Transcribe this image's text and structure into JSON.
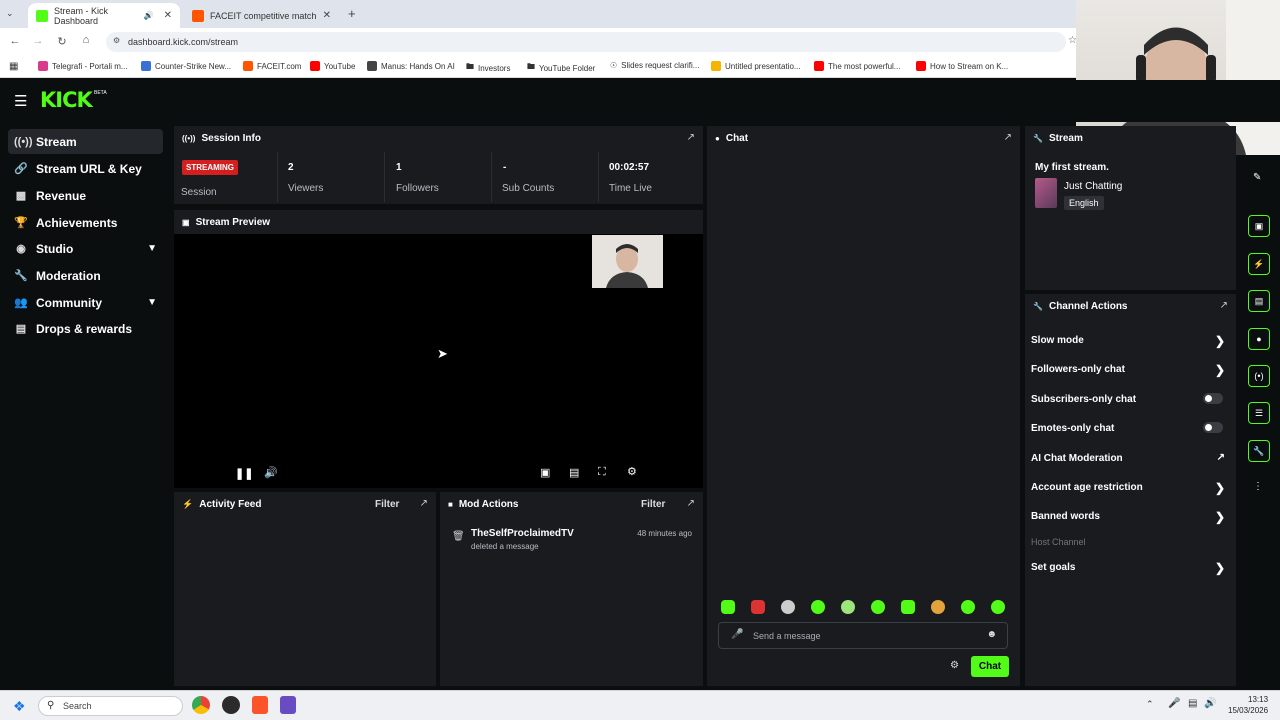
{
  "browser": {
    "tabs": [
      {
        "label": "Stream - Kick Dashboard",
        "color": "#53fc18"
      },
      {
        "label": "FACEIT competitive match - FAC",
        "color": "#ff5500"
      }
    ],
    "url": "dashboard.kick.com/stream",
    "bookmarks": [
      {
        "label": "Telegrafi - Portali m...",
        "color": "#d83a8c"
      },
      {
        "label": "Counter-Strike New...",
        "color": "#3a6fd8"
      },
      {
        "label": "FACEIT.com",
        "color": "#ff5500"
      },
      {
        "label": "YouTube",
        "color": "#ff0000"
      },
      {
        "label": "Manus: Hands On AI",
        "color": "#444444"
      },
      {
        "label": "Investors",
        "color": "#666666"
      },
      {
        "label": "YouTube Folder",
        "color": "#666666"
      },
      {
        "label": "Slides request clarifi...",
        "color": "#888888"
      },
      {
        "label": "Untitled presentatio...",
        "color": "#f4b400"
      },
      {
        "label": "The most powerful...",
        "color": "#ff0000"
      },
      {
        "label": "How to Stream on K...",
        "color": "#ff0000"
      }
    ]
  },
  "app": {
    "logo": "KICK",
    "logo_badge": "BETA",
    "accent": "#53fc18"
  },
  "sidebar": {
    "items": [
      {
        "label": "Stream",
        "icon": "broadcast-icon"
      },
      {
        "label": "Stream URL & Key",
        "icon": "link-icon"
      },
      {
        "label": "Revenue",
        "icon": "chart-icon"
      },
      {
        "label": "Achievements",
        "icon": "trophy-icon"
      },
      {
        "label": "Studio",
        "icon": "palette-icon"
      },
      {
        "label": "Moderation",
        "icon": "wrench-icon"
      },
      {
        "label": "Community",
        "icon": "users-icon"
      },
      {
        "label": "Drops & rewards",
        "icon": "gift-icon"
      }
    ]
  },
  "session": {
    "title": "Session Info",
    "status": "STREAMING",
    "status_label": "Session",
    "viewers": "2",
    "viewers_label": "Viewers",
    "followers": "1",
    "followers_label": "Followers",
    "subs": "-",
    "subs_label": "Sub Counts",
    "time": "00:02:57",
    "time_label": "Time Live"
  },
  "preview": {
    "title": "Stream Preview"
  },
  "activity": {
    "title": "Activity Feed",
    "filter": "Filter"
  },
  "mod": {
    "title": "Mod Actions",
    "filter": "Filter",
    "entries": [
      {
        "user": "TheSelfProclaimedTV",
        "action": "deleted a message",
        "time": "48 minutes ago"
      }
    ]
  },
  "chat": {
    "title": "Chat",
    "placeholder": "Send a message",
    "send_label": "Chat"
  },
  "stream_info": {
    "title": "Stream",
    "stream_title": "My first stream.",
    "category": "Just Chatting",
    "language": "English"
  },
  "channel_actions": {
    "title": "Channel Actions",
    "items": [
      {
        "label": "Slow mode"
      },
      {
        "label": "Followers-only chat"
      },
      {
        "label": "Subscribers-only chat"
      },
      {
        "label": "Emotes-only chat"
      },
      {
        "label": "AI Chat Moderation"
      },
      {
        "label": "Account age restriction"
      },
      {
        "label": "Banned words"
      },
      {
        "label": "Host Channel"
      },
      {
        "label": "Set goals"
      }
    ]
  },
  "taskbar": {
    "search": "Search",
    "time": "13:13",
    "date": "15/03/2026"
  }
}
